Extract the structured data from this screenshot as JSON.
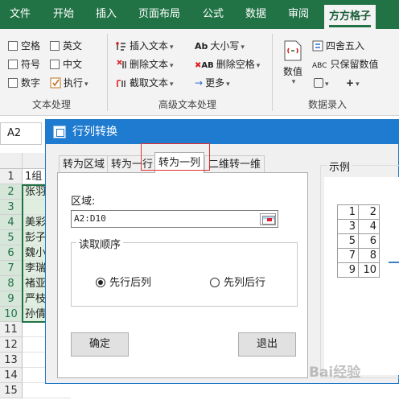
{
  "ribbon_tabs": [
    "文件",
    "开始",
    "插入",
    "页面布局",
    "公式",
    "数据",
    "审阅",
    "方方格子"
  ],
  "ribbon": {
    "text_group": {
      "items": [
        "空格",
        "英文",
        "符号",
        "中文",
        "数字",
        "执行"
      ],
      "label": "文本处理"
    },
    "advanced_group": {
      "items": [
        "插入文本",
        "删除文本",
        "截取文本",
        "大小写",
        "删除空格",
        "更多"
      ],
      "label": "高级文本处理"
    },
    "data_entry_group": {
      "numeric_label": "数值",
      "items": [
        "四舍五入",
        "只保留数值"
      ],
      "label": "数据录入"
    }
  },
  "namebox": "A2",
  "rows": [
    "1",
    "2",
    "3",
    "4",
    "5",
    "6",
    "7",
    "8",
    "9",
    "10",
    "11",
    "12",
    "13",
    "14",
    "15"
  ],
  "cells": [
    "1组",
    "张羽",
    "",
    "美彩",
    "彭子",
    "魏小",
    "李瑞",
    "褚亚",
    "严枝",
    "孙倩",
    "",
    "",
    "",
    "",
    ""
  ],
  "dialog": {
    "title": "行列转换",
    "tabs": [
      "转为区域",
      "转为一行",
      "转为一列",
      "二维转一维"
    ],
    "active_tab": "转为一列",
    "area_label": "区域:",
    "area_value": "A2:D10",
    "order_label": "读取顺序",
    "radio_row_first": "先行后列",
    "radio_col_first": "先列后行",
    "selected_order": "先行后列",
    "ok_button": "确定",
    "exit_button": "退出",
    "example_label": "示例",
    "example_table": [
      [
        "1",
        "2"
      ],
      [
        "3",
        "4"
      ],
      [
        "5",
        "6"
      ],
      [
        "7",
        "8"
      ],
      [
        "9",
        "10"
      ]
    ]
  },
  "watermark": "Bai经验",
  "colors": {
    "ribbon_green": "#217346",
    "dialog_blue": "#1e7bd0",
    "highlight_red": "#e03030"
  }
}
